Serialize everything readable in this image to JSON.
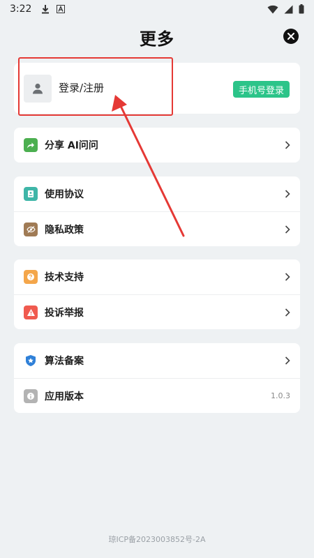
{
  "status_bar": {
    "time": "3:22",
    "icons_left": [
      "download-icon",
      "font-icon"
    ],
    "icons_right": [
      "wifi-icon",
      "signal-icon",
      "battery-icon"
    ]
  },
  "header": {
    "title": "更多",
    "close_icon": "close-circle-icon"
  },
  "login": {
    "label": "登录/注册",
    "button": "手机号登录",
    "button_color": "#2cc489"
  },
  "groups": [
    {
      "items": [
        {
          "label": "分享 AI问问",
          "icon": "share-icon",
          "color": "#4caf50"
        }
      ]
    },
    {
      "items": [
        {
          "label": "使用协议",
          "icon": "document-icon",
          "color": "#3fb6a8"
        },
        {
          "label": "隐私政策",
          "icon": "eye-off-icon",
          "color": "#a07b55"
        }
      ]
    },
    {
      "items": [
        {
          "label": "技术支持",
          "icon": "help-icon",
          "color": "#f4a64a"
        },
        {
          "label": "投诉举报",
          "icon": "warning-icon",
          "color": "#f05a4f"
        }
      ]
    },
    {
      "items": [
        {
          "label": "算法备案",
          "icon": "shield-icon",
          "color": "#2f80d8"
        },
        {
          "label": "应用版本",
          "icon": "info-icon",
          "color": "#b3b3b3",
          "value": "1.0.3"
        }
      ]
    }
  ],
  "footer": {
    "text": "琼ICP备2023003852号-2A"
  },
  "accent_colors": {
    "highlight": "#e53935"
  }
}
